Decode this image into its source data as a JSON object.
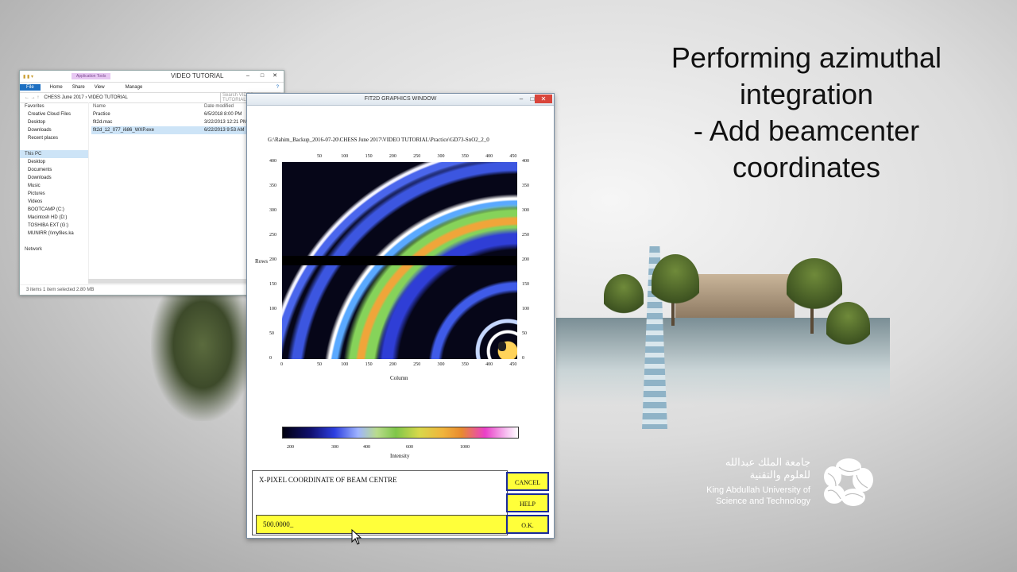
{
  "slide": {
    "title_lines": [
      "Performing azimuthal",
      "integration",
      "- Add beamcenter",
      "coordinates"
    ]
  },
  "logo": {
    "arabic_line1": "جامعة الملك عبدالله",
    "arabic_line2": "للعلوم والتقنية",
    "english_line1": "King Abdullah University of",
    "english_line2": "Science and Technology"
  },
  "explorer": {
    "window_title": "VIDEO TUTORIAL",
    "app_tools_label": "Application Tools",
    "ribbon_tabs": [
      "File",
      "Home",
      "Share",
      "View",
      "Manage"
    ],
    "address_path": "CHESS June 2017 › VIDEO TUTORIAL",
    "search_placeholder": "Search VIDEO TUTORIAL",
    "nav_items": [
      {
        "label": "Favorites",
        "group": true
      },
      {
        "label": "Creative Cloud Files"
      },
      {
        "label": "Desktop"
      },
      {
        "label": "Downloads"
      },
      {
        "label": "Recent places"
      },
      {
        "label": "",
        "spacer": true
      },
      {
        "label": "This PC",
        "group": true,
        "selected": true
      },
      {
        "label": "Desktop"
      },
      {
        "label": "Documents"
      },
      {
        "label": "Downloads"
      },
      {
        "label": "Music"
      },
      {
        "label": "Pictures"
      },
      {
        "label": "Videos"
      },
      {
        "label": "BOOTCAMP (C:)"
      },
      {
        "label": "Macintosh HD (D:)"
      },
      {
        "label": "TOSHIBA EXT (G:)"
      },
      {
        "label": "MUNIRR (\\\\myfiles.ka"
      },
      {
        "label": "",
        "spacer": true
      },
      {
        "label": "Network",
        "group": true
      }
    ],
    "columns": [
      "Name",
      "Date modified"
    ],
    "files": [
      {
        "name": "Practice",
        "date": "6/5/2018 8:00 PM"
      },
      {
        "name": "fit2d.mac",
        "date": "3/22/2013 12:21 PM"
      },
      {
        "name": "fit2d_12_077_i686_WXP.exe",
        "date": "6/22/2013 9:53 AM",
        "selected": true
      }
    ],
    "status": "3 items     1 item selected  2.80 MB"
  },
  "fit2d": {
    "window_title": "FIT2D GRAPHICS WINDOW",
    "file_path": "G:\\Rahim_Backup_2016-07-20\\CHESS June 2017\\VIDEO TUTORIAL\\Practice\\GD73-SnO2_2_0",
    "x_ticks_top": [
      "50",
      "100",
      "150",
      "200",
      "250",
      "300",
      "350",
      "400",
      "450"
    ],
    "x_ticks_bottom": [
      "50",
      "100",
      "150",
      "200",
      "250",
      "300",
      "350",
      "400",
      "450"
    ],
    "y_ticks": [
      "400",
      "350",
      "300",
      "250",
      "200",
      "150",
      "100",
      "50",
      "0"
    ],
    "x_tick_zero": "0",
    "xlabel": "Column",
    "ylabel": "Rows",
    "colorbar_ticks": [
      "200",
      "300",
      "400",
      "600",
      "1000"
    ],
    "colorbar_label": "Intensity",
    "prompt": "X-PIXEL COORDINATE OF BEAM CENTRE",
    "input_value": "500.0000_",
    "buttons": {
      "cancel": "CANCEL",
      "help": "HELP",
      "ok": "O.K."
    }
  }
}
